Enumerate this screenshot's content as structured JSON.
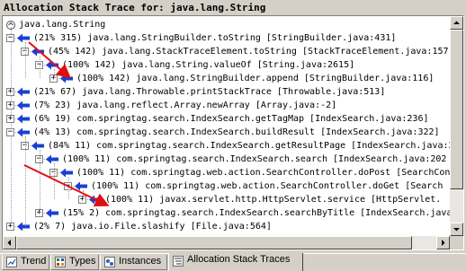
{
  "panel": {
    "title": "Allocation Stack Trace for: java.lang.String"
  },
  "colors": {
    "tree_arrow": "#1a3fd6",
    "annotation_arrow": "#e01010"
  },
  "tree": {
    "root_label": "java.lang.String",
    "rows": [
      {
        "label": "(21% 315) java.lang.StringBuilder.toString [StringBuilder.java:431]",
        "expander": "−"
      },
      {
        "label": "(45% 142) java.lang.StackTraceElement.toString [StackTraceElement.java:157]",
        "expander": "−"
      },
      {
        "label": "(100% 142) java.lang.String.valueOf [String.java:2615]",
        "expander": "−"
      },
      {
        "label": "(100% 142) java.lang.StringBuilder.append [StringBuilder.java:116]",
        "expander": "+"
      },
      {
        "label": "(21% 67) java.lang.Throwable.printStackTrace [Throwable.java:513]",
        "expander": "+"
      },
      {
        "label": "(7% 23) java.lang.reflect.Array.newArray [Array.java:-2]",
        "expander": "+"
      },
      {
        "label": "(6% 19) com.springtag.search.IndexSearch.getTagMap [IndexSearch.java:236]",
        "expander": "+"
      },
      {
        "label": "(4% 13) com.springtag.search.IndexSearch.buildResult [IndexSearch.java:322]",
        "expander": "−"
      },
      {
        "label": "(84% 11) com.springtag.search.IndexSearch.getResultPage [IndexSearch.java:2",
        "expander": "−"
      },
      {
        "label": "(100% 11) com.springtag.search.IndexSearch.search [IndexSearch.java:202",
        "expander": "−"
      },
      {
        "label": "(100% 11) com.springtag.web.action.SearchController.doPost [SearchCon",
        "expander": "−"
      },
      {
        "label": "(100% 11) com.springtag.web.action.SearchController.doGet [Search",
        "expander": "−"
      },
      {
        "label": "(100% 11) javax.servlet.http.HttpServlet.service [HttpServlet.",
        "expander": "+"
      },
      {
        "label": "(15% 2) com.springtag.search.IndexSearch.searchByTitle [IndexSearch.java:98",
        "expander": "+"
      },
      {
        "label": "(2% 7) java.io.File.slashify [File.java:564]",
        "expander": "+"
      }
    ]
  },
  "tabs": [
    {
      "label": "Trend",
      "icon": "trend-icon",
      "active": false
    },
    {
      "label": "Types",
      "icon": "types-icon",
      "active": false
    },
    {
      "label": "Instances",
      "icon": "instances-icon",
      "active": false
    },
    {
      "label": "Allocation Stack Traces",
      "icon": "stack-traces-icon",
      "active": true
    }
  ]
}
